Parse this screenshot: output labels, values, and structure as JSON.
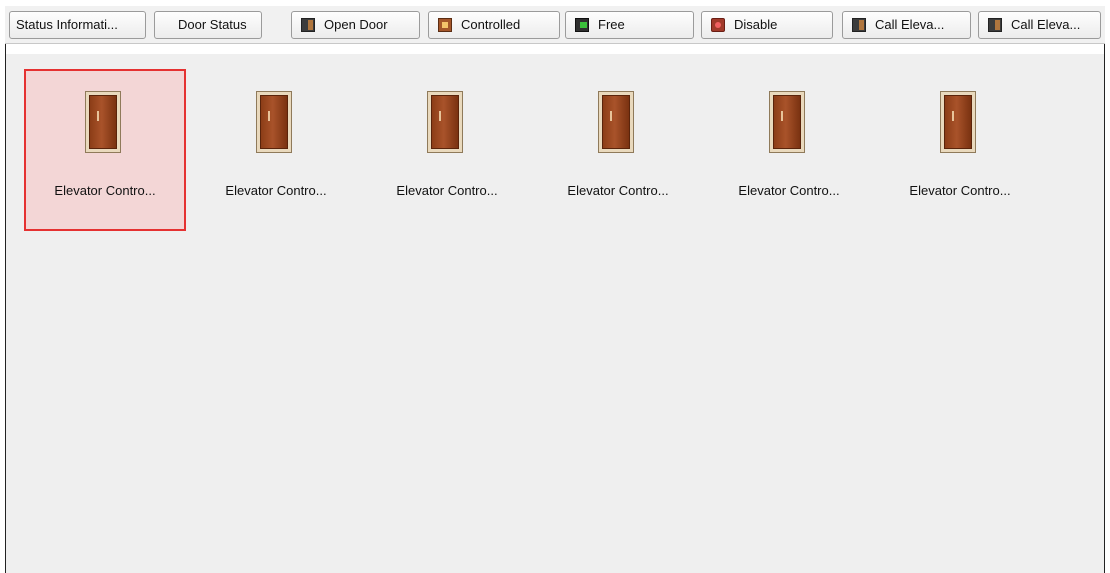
{
  "toolbar": {
    "buttons": [
      {
        "label": "Status Informati...",
        "icon": "none"
      },
      {
        "label": "Door Status",
        "icon": "none"
      },
      {
        "label": "Open Door",
        "icon": "door-open-icon"
      },
      {
        "label": "Controlled",
        "icon": "door-controlled-icon"
      },
      {
        "label": "Free",
        "icon": "door-free-icon"
      },
      {
        "label": "Disable",
        "icon": "door-disable-icon"
      },
      {
        "label": "Call Eleva...",
        "icon": "call-elevator-icon"
      },
      {
        "label": "Call Eleva...",
        "icon": "call-elevator-icon"
      }
    ]
  },
  "devices": {
    "items": [
      {
        "label": "Elevator Contro...",
        "selected": true
      },
      {
        "label": "Elevator Contro...",
        "selected": false
      },
      {
        "label": "Elevator Contro...",
        "selected": false
      },
      {
        "label": "Elevator Contro...",
        "selected": false
      },
      {
        "label": "Elevator Contro...",
        "selected": false
      },
      {
        "label": "Elevator Contro...",
        "selected": false
      }
    ]
  },
  "colors": {
    "selection_border": "#e53131",
    "selection_fill": "#f3d6d6",
    "door_brown": "#a9532a",
    "panel_background": "#efefef"
  }
}
